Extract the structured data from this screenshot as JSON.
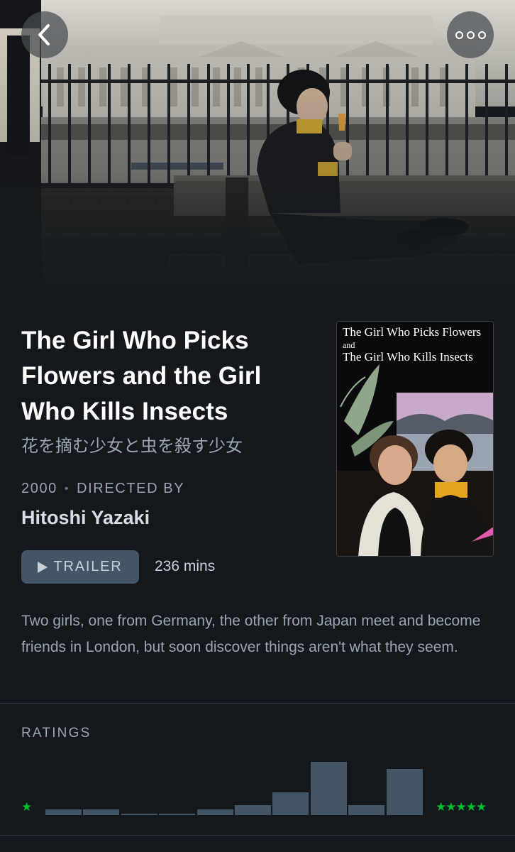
{
  "header": {
    "back_icon": "chevron-left-icon",
    "more_icon": "more-horizontal-icon"
  },
  "film": {
    "title": "The Girl Who Picks Flowers and the Girl Who Kills Insects",
    "original_title": "花を摘む少女と虫を殺す少女",
    "year": "2000",
    "directed_by_label": "DIRECTED BY",
    "director": "Hitoshi Yazaki",
    "trailer_label": "TRAILER",
    "runtime": "236 mins",
    "synopsis": "Two girls, one from Germany, the other from Japan meet and become friends in London, but soon discover things aren't what they seem."
  },
  "poster": {
    "line1": "The Girl Who Picks Flowers",
    "and": "and",
    "line2": "The Girl Who Kills Insects"
  },
  "ratings": {
    "heading": "RATINGS",
    "low_label": "★",
    "high_label": "★★★★★",
    "histogram": [
      0.11,
      0.11,
      0.03,
      0.03,
      0.11,
      0.18,
      0.42,
      1.0,
      0.18,
      0.86
    ]
  },
  "colors": {
    "background": "#14181c",
    "accent_green": "#00c030",
    "button": "#445566",
    "secondary_text": "#9aa5b1"
  }
}
